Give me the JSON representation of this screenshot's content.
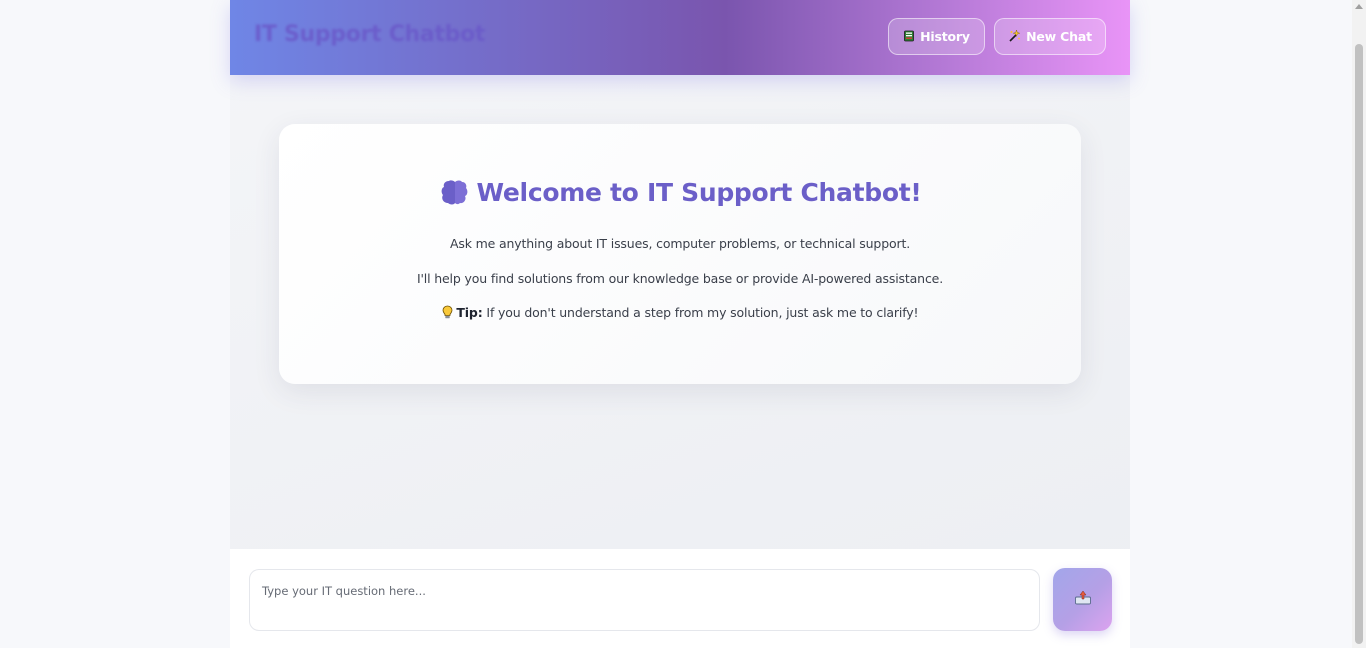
{
  "header": {
    "title": "IT Support Chatbot",
    "history_label": "History",
    "history_icon": "ledger-icon",
    "new_chat_label": "New Chat",
    "new_chat_icon": "sparkle-icon"
  },
  "welcome": {
    "icon": "brain-icon",
    "title": "Welcome to IT Support Chatbot!",
    "line1": "Ask me anything about IT issues, computer problems, or technical support.",
    "line2": "I'll help you find solutions from our knowledge base or provide AI-powered assistance.",
    "tip_icon": "lightbulb-icon",
    "tip_label": "Tip:",
    "tip_text": " If you don't understand a step from my solution, just ask me to clarify!"
  },
  "composer": {
    "placeholder": "Type your IT question here...",
    "value": "",
    "send_icon": "send-tray-icon"
  },
  "colors": {
    "header_gradient_start": "#6f86e6",
    "header_gradient_mid": "#7a55ae",
    "header_gradient_end": "#e994f7",
    "accent": "#6b5fc8"
  }
}
